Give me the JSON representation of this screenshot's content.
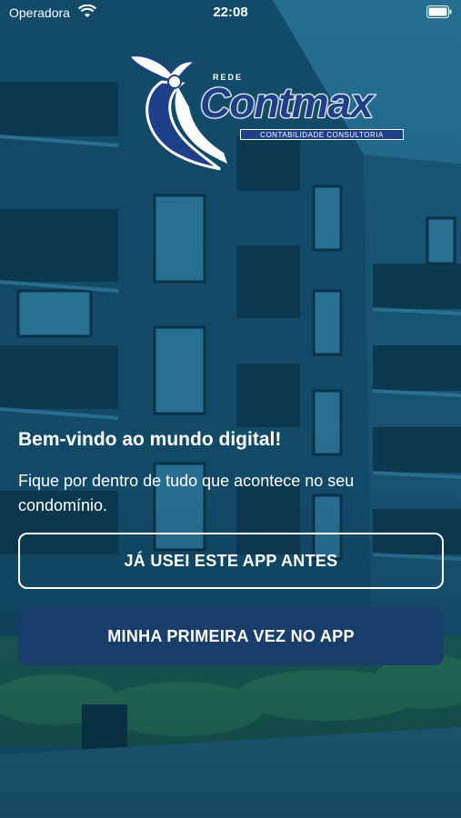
{
  "status_bar": {
    "carrier": "Operadora",
    "time": "22:08"
  },
  "logo": {
    "small": "REDE",
    "name": "Contmax",
    "tagline": "CONTABILIDADE CONSULTORIA"
  },
  "welcome": {
    "title": "Bem-vindo ao mundo digital!",
    "text": "Fique por dentro de tudo que acontece no seu condomínio."
  },
  "buttons": {
    "returning_label": "JÁ USEI ESTE APP ANTES",
    "first_time_label": "MINHA PRIMEIRA VEZ NO APP"
  },
  "colors": {
    "overlay": "#0f4a6a",
    "primary_button": "#193e6b",
    "logo_blue": "#1e3f8a"
  }
}
